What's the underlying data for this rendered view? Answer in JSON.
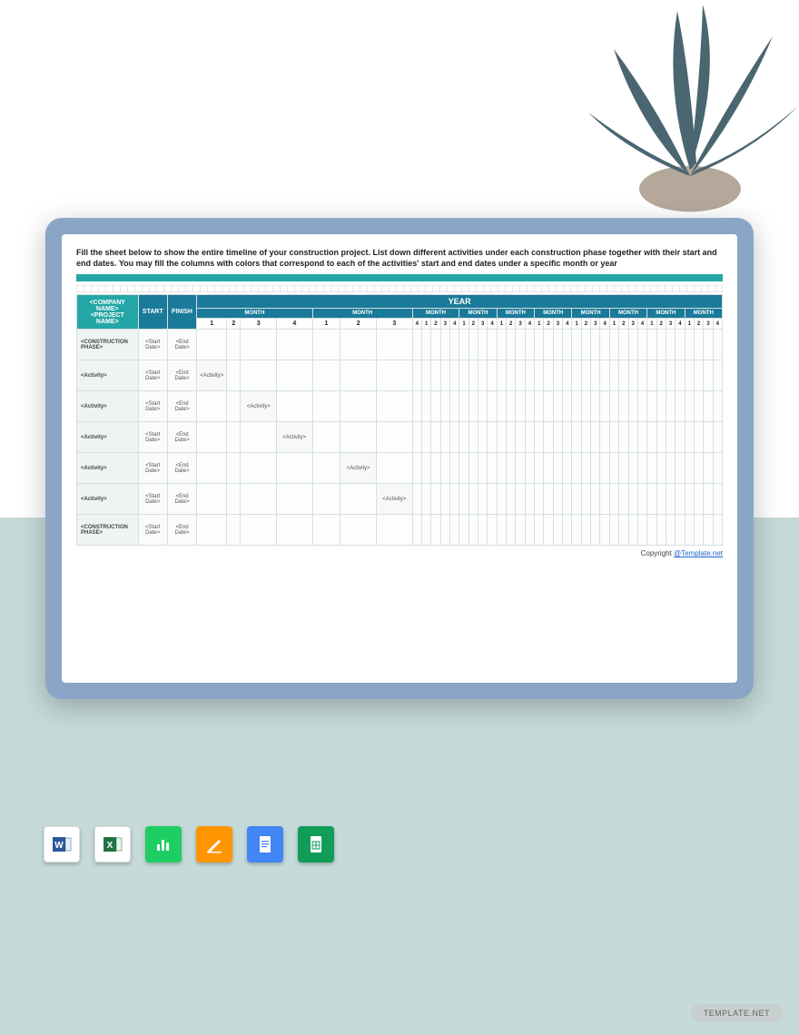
{
  "instructions": "Fill the sheet below to show the entire timeline of your construction project. List down different activities under each construction phase together with their start and end dates. You may fill the columns with colors that correspond to each of the activities' start and end dates under a specific month or year",
  "headers": {
    "company": "<COMPANY NAME>",
    "project": "<PROJECT NAME>",
    "start": "START",
    "finish": "FINISH",
    "year": "YEAR",
    "month": "MONTH"
  },
  "week_numbers_wide": [
    "1",
    "2",
    "3",
    "4",
    "1",
    "2",
    "3"
  ],
  "small_weeks": [
    "4",
    "1",
    "2",
    "3",
    "4",
    "1",
    "2",
    "3",
    "4",
    "1",
    "2",
    "3",
    "4",
    "1",
    "2",
    "3",
    "4",
    "1",
    "2",
    "3",
    "4",
    "1",
    "2",
    "3",
    "4",
    "1",
    "2",
    "3",
    "4",
    "1",
    "2",
    "3",
    "4"
  ],
  "rows": [
    {
      "label": "<CONSTRUCTION PHASE>",
      "start": "<Start Date>",
      "end": "<End Date>",
      "activity_col": -1
    },
    {
      "label": "<Activity>",
      "start": "<Start Date>",
      "end": "<End Date>",
      "activity_col": 0
    },
    {
      "label": "<Activity>",
      "start": "<Start Date>",
      "end": "<End Date>",
      "activity_col": 1
    },
    {
      "label": "<Activity>",
      "start": "<Start Date>",
      "end": "<End Date>",
      "activity_col": 2
    },
    {
      "label": "<Activity>",
      "start": "<Start Date>",
      "end": "<End Date>",
      "activity_col": 3
    },
    {
      "label": "<Activity>",
      "start": "<Start Date>",
      "end": "<End Date>",
      "activity_col": 4
    },
    {
      "label": "<CONSTRUCTION PHASE>",
      "start": "<Start Date>",
      "end": "<End Date>",
      "activity_col": -1
    }
  ],
  "activity_text": "<Activity>",
  "copyright": "Copyright ",
  "copyright_link": "@Template.net",
  "watermark": "TEMPLATE.NET",
  "icons": {
    "word": "#2b579a",
    "excel": "#217346",
    "numbers": "#1fce63",
    "pages": "#ff9500",
    "docs": "#4285f4",
    "sheets": "#0f9d58"
  }
}
